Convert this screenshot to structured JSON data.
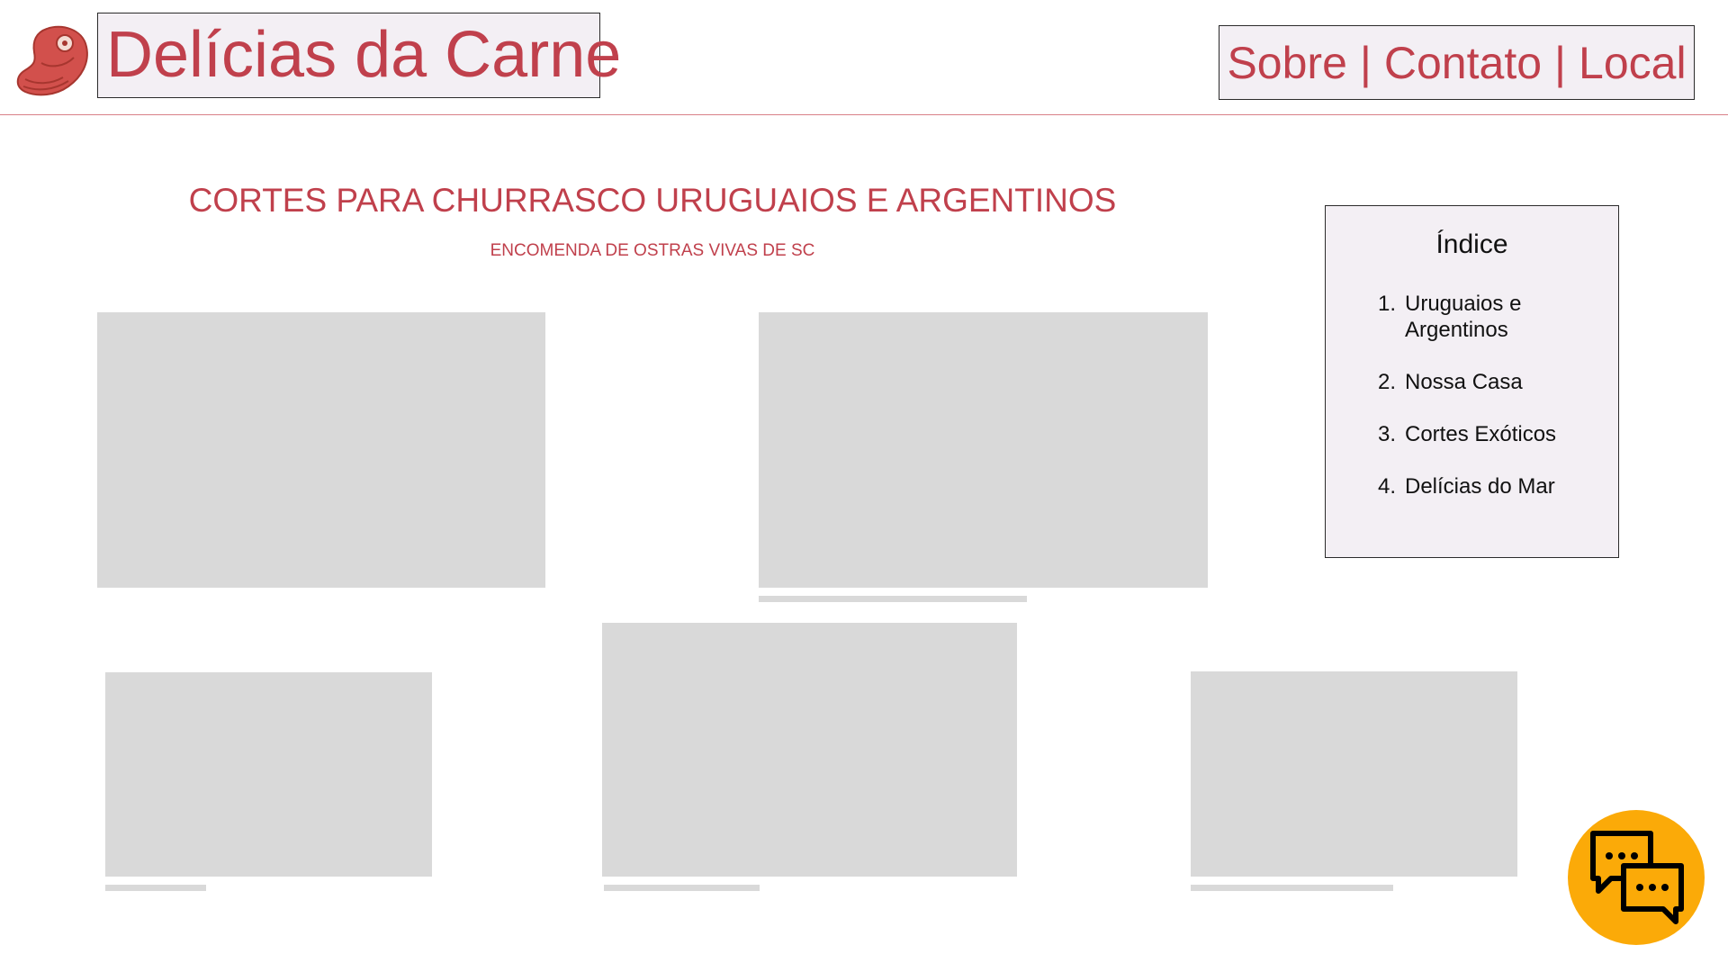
{
  "header": {
    "logo_icon": "steak-icon",
    "brand_title": "Delícias da Carne",
    "nav": {
      "about": "Sobre",
      "contact": "Contato",
      "location": "Local",
      "separator": "|"
    }
  },
  "main": {
    "title": "CORTES PARA CHURRASCO URUGUAIOS E ARGENTINOS",
    "subtitle": "ENCOMENDA DE OSTRAS VIVAS DE SC"
  },
  "index": {
    "title": "Índice",
    "items": [
      {
        "number": "1.",
        "label_line1": "Uruguaios e",
        "label_line2": "Argentinos"
      },
      {
        "number": "2.",
        "label": "Nossa Casa"
      },
      {
        "number": "3.",
        "label": "Cortes Exóticos"
      },
      {
        "number": "4.",
        "label": "Delícias do Mar"
      }
    ]
  },
  "chat": {
    "icon": "chat-bubbles-icon"
  },
  "colors": {
    "brand_red": "#c0404c",
    "panel_bg": "#f3eff4",
    "placeholder": "#d9d9d9",
    "chat_button": "#fbaa08"
  }
}
